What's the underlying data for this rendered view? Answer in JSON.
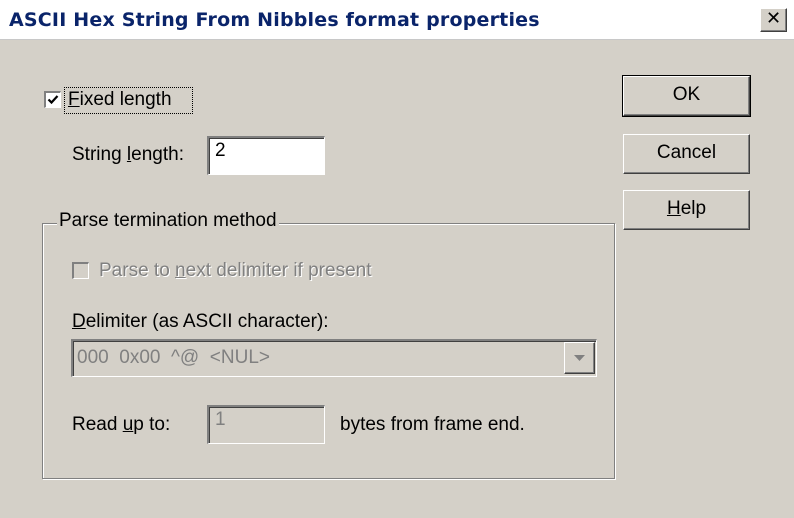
{
  "window": {
    "title": "ASCII Hex String From Nibbles format properties",
    "close_glyph": "✕"
  },
  "fixed_length": {
    "checked": true,
    "label_mnemonic": "F",
    "label_rest": "ixed length"
  },
  "string_length": {
    "label_pre": "String ",
    "label_mnemonic": "l",
    "label_post": "ength:",
    "value": "2"
  },
  "parse_termination": {
    "group_label": "Parse termination method",
    "parse_next": {
      "checked": false,
      "label_pre": "Parse to ",
      "label_mnemonic": "n",
      "label_post": "ext delimiter if present"
    },
    "delimiter": {
      "label_mnemonic": "D",
      "label_rest": "elimiter (as ASCII character):",
      "selected_value": "000  0x00  ^@  <NUL>"
    },
    "read_up_to": {
      "label_pre": "Read ",
      "label_mnemonic": "u",
      "label_post": "p to:",
      "value": "1",
      "suffix": "bytes from frame end."
    }
  },
  "buttons": {
    "ok": "OK",
    "cancel": "Cancel",
    "help_mnemonic": "H",
    "help_rest": "elp"
  },
  "colors": {
    "dialog_bg": "#d4d0c8",
    "title_text": "#0a246a",
    "disabled_text": "#808080"
  }
}
